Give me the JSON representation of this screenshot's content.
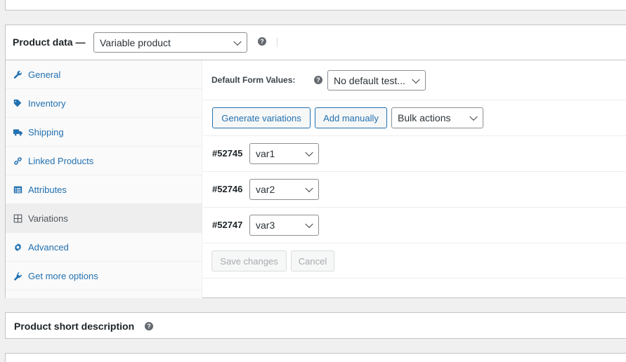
{
  "product_data": {
    "title": "Product data —",
    "type_select": "Variable product",
    "help": "?"
  },
  "tabs": [
    {
      "label": "General",
      "icon": "wrench-icon"
    },
    {
      "label": "Inventory",
      "icon": "tag-icon"
    },
    {
      "label": "Shipping",
      "icon": "truck-icon"
    },
    {
      "label": "Linked Products",
      "icon": "link-icon"
    },
    {
      "label": "Attributes",
      "icon": "list-icon"
    },
    {
      "label": "Variations",
      "icon": "grid-icon"
    },
    {
      "label": "Advanced",
      "icon": "gear-icon"
    },
    {
      "label": "Get more options",
      "icon": "plugin-icon"
    }
  ],
  "variations": {
    "default_form_label": "Default Form Values:",
    "default_form_help": "?",
    "default_form_value": "No default test...",
    "generate_button": "Generate variations",
    "add_manually_button": "Add manually",
    "bulk_actions": "Bulk actions",
    "items": [
      {
        "id": "#52745",
        "value": "var1"
      },
      {
        "id": "#52746",
        "value": "var2"
      },
      {
        "id": "#52747",
        "value": "var3"
      }
    ],
    "save_button": "Save changes",
    "cancel_button": "Cancel"
  },
  "short_description": {
    "title": "Product short description",
    "help": "?"
  },
  "colors": {
    "link": "#2271b1",
    "border": "#c3c4c7",
    "background": "#f0f0f1"
  }
}
